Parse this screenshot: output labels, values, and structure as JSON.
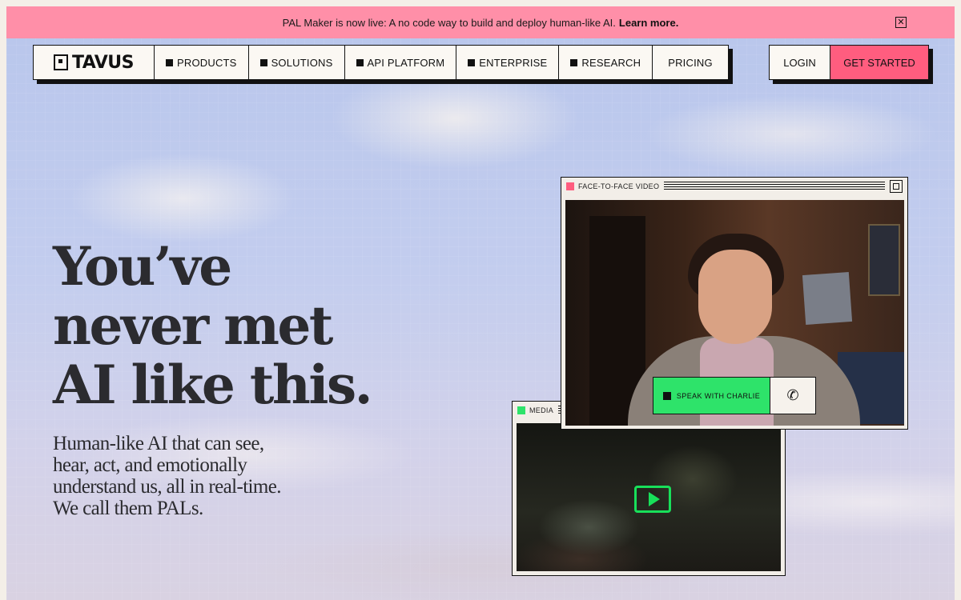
{
  "announcement": {
    "text": "PAL Maker is now live: A no code way to build and deploy human-like AI.",
    "link_label": "Learn more.",
    "close_icon": "close-icon",
    "background": "#ff8fa8"
  },
  "nav": {
    "brand": "TAVUS",
    "items": [
      {
        "label": "PRODUCTS"
      },
      {
        "label": "SOLUTIONS"
      },
      {
        "label": "API PLATFORM"
      },
      {
        "label": "ENTERPRISE"
      },
      {
        "label": "RESEARCH"
      },
      {
        "label": "PRICING"
      }
    ],
    "login_label": "LOGIN",
    "cta_label": "GET STARTED",
    "cta_color": "#ff5d7f"
  },
  "hero": {
    "title_lines": [
      "You’ve",
      "never met",
      "AI like this."
    ],
    "subtitle": "Human-like AI that can see, hear, act, and emotionally understand us, all in real-time. We call them PALs."
  },
  "video_window": {
    "title": "FACE-TO-FACE VIDEO",
    "title_dot_color": "#ff5d7f",
    "speak_label": "SPEAK WITH CHARLIE",
    "call_icon": "phone-icon",
    "speak_color": "#2ee36a"
  },
  "media_window": {
    "title": "MEDIA",
    "title_dot_color": "#2ee36a",
    "play_icon": "play-icon"
  }
}
